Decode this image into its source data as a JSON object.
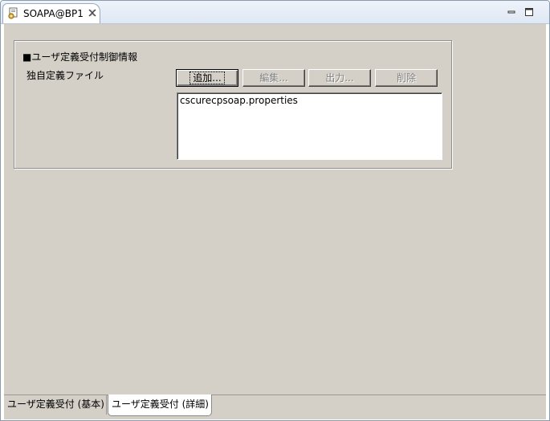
{
  "editor_tab": {
    "title": "SOAPA@BP1",
    "close_glyph": "⊠",
    "icon": "soap-document-icon"
  },
  "window_controls": {
    "minimize_icon": "minimize-icon",
    "maximize_icon": "maximize-icon"
  },
  "section": {
    "title": "■ユーザ定義受付制御情報",
    "field_label": "独自定義ファイル",
    "buttons": {
      "add": "追加...",
      "edit": "編集...",
      "output": "出力...",
      "delete": "削除"
    },
    "file_list": [
      "cscurecpsoap.properties"
    ]
  },
  "bottom_tabs": [
    {
      "label": "ユーザ定義受付 (基本)",
      "active": false
    },
    {
      "label": "ユーザ定義受付 (詳細)",
      "active": true
    }
  ],
  "colors": {
    "panel_bg": "#d4d0c8",
    "title_strip": "#dfe8f4",
    "window_border": "#8a9aab"
  }
}
